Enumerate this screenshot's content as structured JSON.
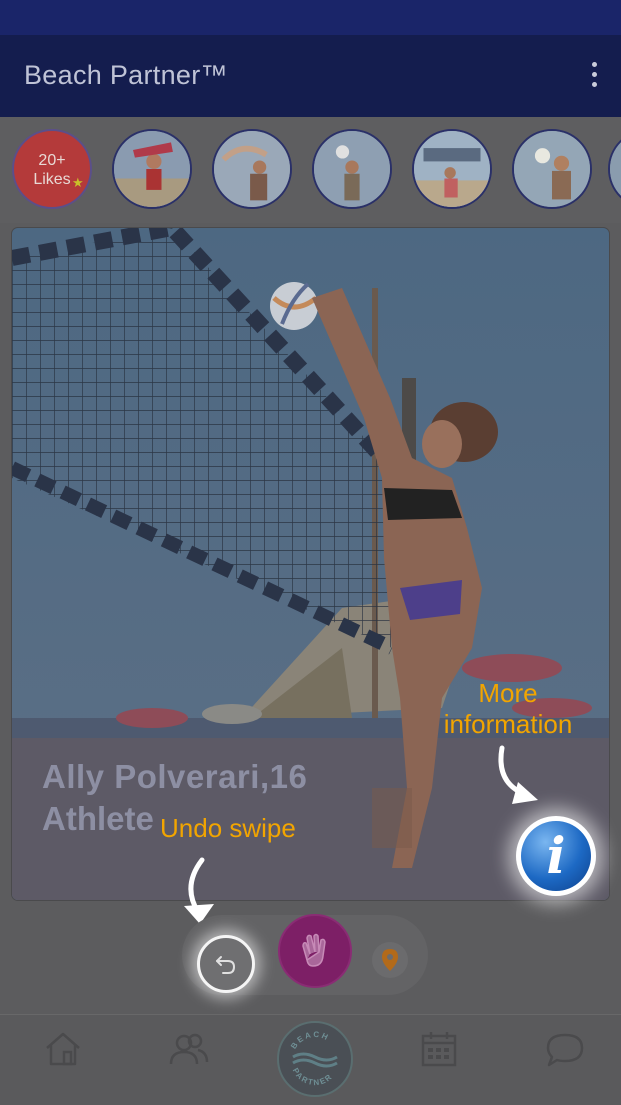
{
  "app": {
    "title": "Beach Partner™"
  },
  "stories": {
    "likes_label": "20+\nLikes",
    "likes_line1": "20+",
    "likes_line2": "Likes",
    "count": 6
  },
  "card": {
    "name": "Ally Polverari,16",
    "role": "Athlete"
  },
  "hints": {
    "more_info": "More\ninformation",
    "more_info_line1": "More",
    "more_info_line2": "information",
    "undo": "Undo swipe"
  },
  "colors": {
    "status_bar": "#1a2569",
    "app_bar": "#141d4e",
    "hint_text": "#f2a500",
    "hi_button": "#7d1f66",
    "info_button": "#1d69c4"
  },
  "icons": {
    "menu": "more-vertical-icon",
    "info": "info-icon",
    "undo": "undo-icon",
    "hi": "waving-hand-icon",
    "location": "location-pin-icon",
    "nav": [
      "home-icon",
      "connections-icon",
      "beach-partner-logo",
      "calendar-icon",
      "chat-icon"
    ]
  },
  "logo_text": {
    "top": "BEACH",
    "bottom": "PARTNER"
  }
}
